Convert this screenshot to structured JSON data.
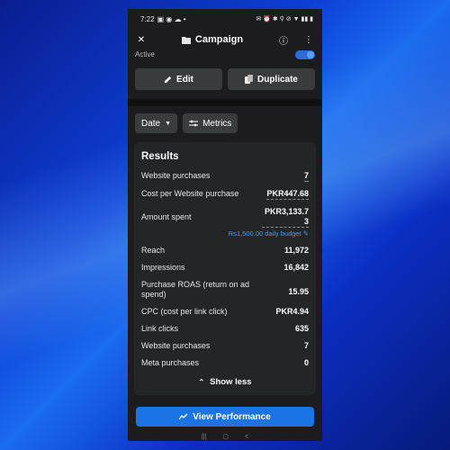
{
  "statusbar": {
    "time": "7:22",
    "left_icons": "▣ ◉ ☁ •",
    "right_icons": "✉ ⏰ ✱ ⚲ ⊘ ▼ ▮▮ ▮"
  },
  "appbar": {
    "title": "Campaign",
    "close_icon": "✕",
    "info_icon": "ⓘ",
    "more_icon": "⋮"
  },
  "active_label": "Active",
  "buttons": {
    "edit": "Edit",
    "duplicate": "Duplicate"
  },
  "filters": {
    "date": "Date",
    "metrics": "Metrics"
  },
  "results": {
    "title": "Results",
    "rows": [
      {
        "label": "Website purchases",
        "value": "7"
      },
      {
        "label": "Cost per Website purchase",
        "value": "PKR447.68"
      },
      {
        "label": "Amount spent",
        "value": "PKR3,133.73"
      },
      {
        "label": "Reach",
        "value": "11,972"
      },
      {
        "label": "Impressions",
        "value": "16,842"
      },
      {
        "label": "Purchase ROAS (return on ad spend)",
        "value": "15.95"
      },
      {
        "label": "CPC (cost per link click)",
        "value": "PKR4.94"
      },
      {
        "label": "Link clicks",
        "value": "635"
      },
      {
        "label": "Website purchases",
        "value": "7"
      },
      {
        "label": "Meta purchases",
        "value": "0"
      }
    ],
    "budget_note": "Rs1,500.00 daily budget",
    "show_less": "Show less"
  },
  "view_performance": "View Performance",
  "colors": {
    "accent": "#1b74e4",
    "link": "#4599ff",
    "card": "#242526",
    "surface": "#1c1c1e"
  }
}
